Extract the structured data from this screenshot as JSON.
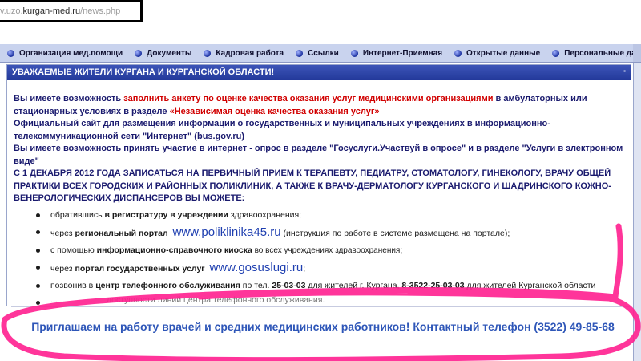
{
  "address_bar": {
    "prefix": "v.uzo.",
    "host": "kurgan-med.ru",
    "path": "/news.php"
  },
  "nav": {
    "items": [
      "Организация мед.помощи",
      "Документы",
      "Кадровая работа",
      "Ссылки",
      "Интернет-Приемная",
      "Открытые данные",
      "Персональные данн"
    ]
  },
  "banner": {
    "title": "УВАЖАЕМЫЕ ЖИТЕЛИ КУРГАНА И КУРГАНСКОЙ ОБЛАСТИ!"
  },
  "content": {
    "p1_a": "Вы имеете возможность ",
    "p1_red": "заполнить анкету по оценке качества оказания услуг медицинскими организациями",
    "p1_b": " в амбулаторных или стационарных условиях в разделе ",
    "p1_red2": "«Независимая оценка качества оказания услуг»",
    "p2": "Официальный сайт для размещения информации о государственных и муниципальных учреждениях в информационно-телекоммуникационной сети \"Интернет\" (bus.gov.ru)",
    "p3": "Вы имеете возможность принять участие в интернет - опрос в разделе \"Госуслуги.Участвуй в опросе\" и в разделе \"Услуги в электронном виде\"",
    "p4": "С 1 ДЕКАБРЯ 2012 ГОДА ЗАПИСАТЬСЯ НА ПЕРВИЧНЫЙ ПРИЕМ К ТЕРАПЕВТУ, ПЕДИАТРУ, СТОМАТОЛОГУ, ГИНЕКОЛОГУ, ВРАЧУ ОБЩЕЙ ПРАКТИКИ ВСЕХ ГОРОДСКИХ И РАЙОННЫХ ПОЛИКЛИНИК, А ТАКЖЕ К ВРАЧУ-ДЕРМАТОЛОГУ КУРГАНСКОГО И ШАДРИНСКОГО КОЖНО-ВЕНЕРОЛОГИЧЕСКИХ ДИСПАНСЕРОВ ВЫ МОЖЕТЕ:"
  },
  "list": {
    "i1_a": "обратившись ",
    "i1_b": "в регистратуру в учреждении",
    "i1_c": " здравоохранения;",
    "i2_a": "через ",
    "i2_b": "региональный портал",
    "i2_link": "www.poliklinika45.ru",
    "i2_c": " (инструкция по работе в системе размещена на портале);",
    "i3_a": "с помощью ",
    "i3_b": "информационно-справочного киоска",
    "i3_c": " во всех учреждениях здравоохранения;",
    "i4_a": "через ",
    "i4_b": "портал государственных услуг",
    "i4_link": "www.gosuslugi.ru",
    "i4_c": ";",
    "i5_a": "позвонив в ",
    "i5_b": "центр телефонного обслуживания",
    "i5_c": " по тел. ",
    "i5_d": "25-03-03",
    "i5_e": " для жителей г. Кургана, ",
    "i5_f": "8-3522-25-03-03",
    "i5_g": " для жителей Курганской области",
    "i6": "... ... ... ... ... ... доступности линий центра телефонного обслуживания."
  },
  "invite": {
    "text": "Приглашаем на работу врачей и средних медицинских работников! Контактный телефон (3522) 49-85-68"
  },
  "colors": {
    "banner": "#2a40a5",
    "nav": "#c9d3ee",
    "red_text": "#d10000",
    "link": "#1f3fb0",
    "annotation": "#ff1f8f"
  }
}
